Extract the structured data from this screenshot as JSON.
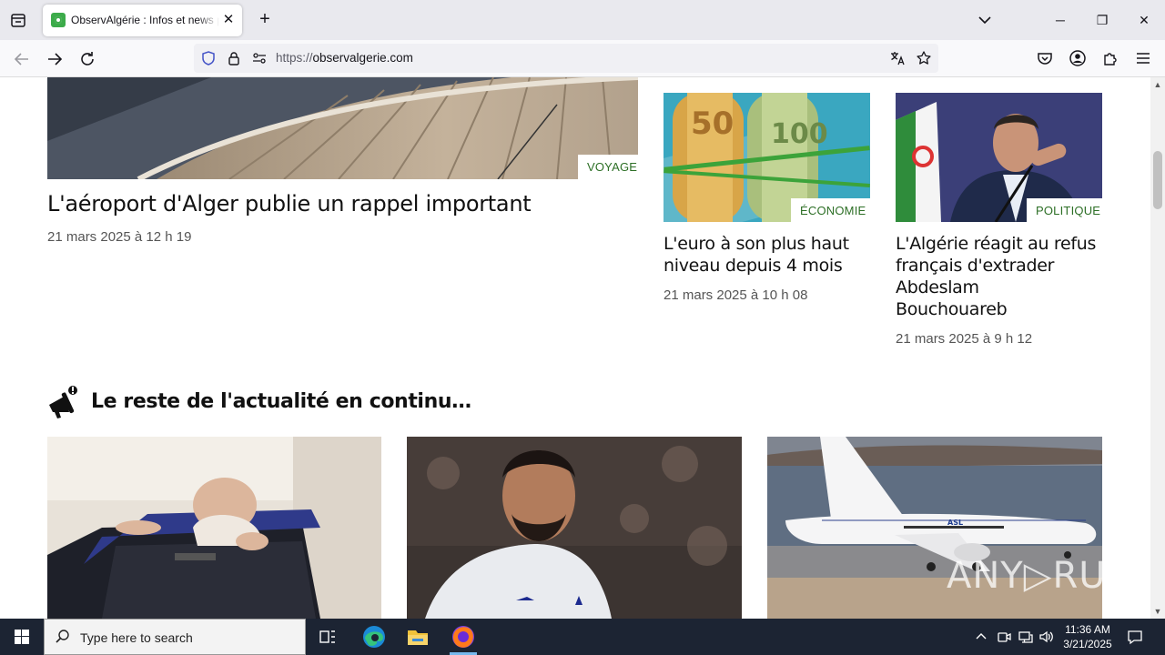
{
  "browser": {
    "tab_title": "ObservAlgérie : Infos et news p",
    "tab_close": "✕",
    "new_tab": "+",
    "url_protocol": "https://",
    "url_host": "observalgerie.com",
    "window_controls": {
      "minimize": "─",
      "restore": "❐",
      "close": "✕"
    }
  },
  "featured": {
    "main": {
      "category": "VOYAGE",
      "title": "L'aéroport d'Alger publie un rappel important",
      "date": "21 mars 2025 à 12 h 19"
    },
    "side": [
      {
        "category": "ÉCONOMIE",
        "title_lines": [
          "L'euro à son plus haut",
          "niveau depuis 4 mois"
        ],
        "date": "21 mars 2025 à 10 h 08"
      },
      {
        "category": "POLITIQUE",
        "title_lines": [
          "L'Algérie réagit au refus",
          "français d'extrader",
          "Abdeslam",
          "Bouchouareb"
        ],
        "date": "21 mars 2025 à 9 h 12"
      }
    ]
  },
  "section": {
    "title": "Le reste de l'actualité en continu…"
  },
  "watermark": "ANY▷RUN",
  "taskbar": {
    "search_placeholder": "Type here to search",
    "time": "11:36 AM",
    "date": "3/21/2025"
  },
  "icons": {
    "tab_list": "tab-list-icon",
    "back": "arrow-left-icon",
    "forward": "arrow-right-icon",
    "reload": "reload-icon",
    "shield": "tracking-protection-icon",
    "lock": "lock-icon",
    "permissions": "permissions-icon",
    "translate": "translate-icon",
    "bookmark": "star-icon",
    "pocket": "pocket-icon",
    "account": "account-icon",
    "extensions": "extensions-icon",
    "menu": "hamburger-menu-icon",
    "megaphone": "megaphone-icon"
  },
  "colors": {
    "category_green": "#2d6f26",
    "taskbar": "#1c2433",
    "favicon_green": "#3cab4a"
  }
}
